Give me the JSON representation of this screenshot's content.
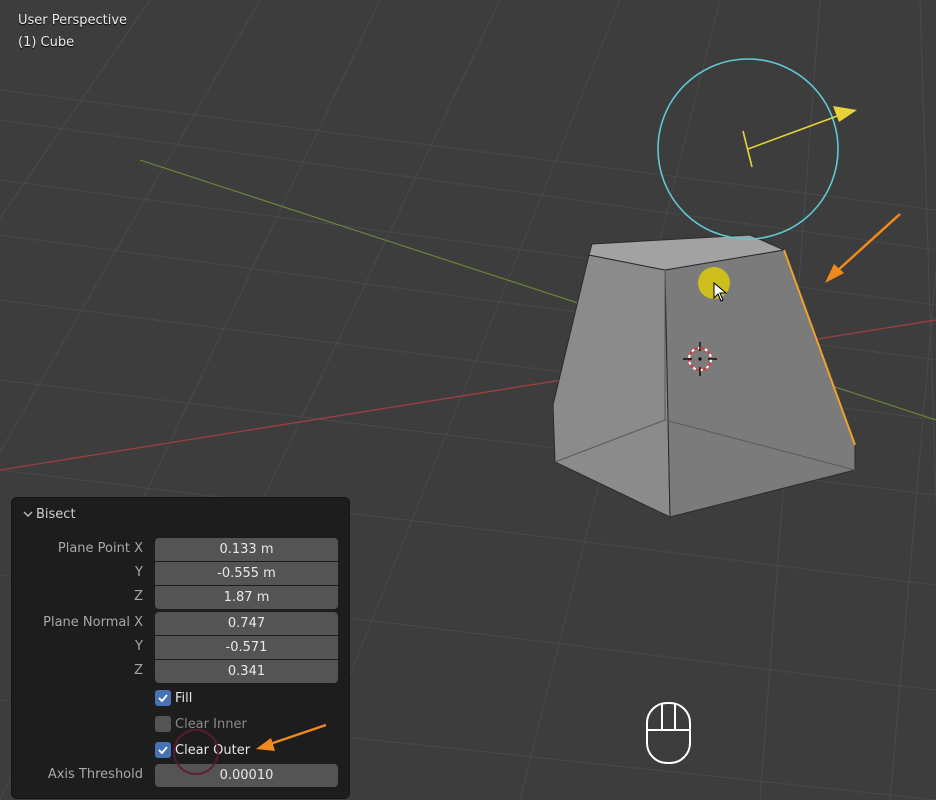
{
  "viewport": {
    "mode_label": "User Perspective",
    "object_label": "(1) Cube"
  },
  "operator_panel": {
    "title": "Bisect",
    "plane_point": {
      "label": "Plane Point X",
      "y_label": "Y",
      "z_label": "Z",
      "x": "0.133 m",
      "y": "-0.555 m",
      "z": "1.87 m"
    },
    "plane_normal": {
      "label": "Plane Normal X",
      "y_label": "Y",
      "z_label": "Z",
      "x": "0.747",
      "y": "-0.571",
      "z": "0.341"
    },
    "fill": {
      "label": "Fill",
      "checked": true
    },
    "clear_inner": {
      "label": "Clear Inner",
      "checked": false
    },
    "clear_outer": {
      "label": "Clear Outer",
      "checked": true
    },
    "axis_threshold": {
      "label": "Axis Threshold",
      "value": "0.00010"
    }
  },
  "colors": {
    "viewport_bg": "#3d3d3d",
    "grid": "#4a4a4a",
    "x_axis": "#9e3f3f",
    "y_axis": "#6e8a3a",
    "gizmo_ring": "#5fc9d6",
    "gizmo_arrow": "#e8d23a",
    "annotation_arrow": "#f08a1c",
    "checkbox_on": "#4772b3",
    "panel_bg": "#1d1d1d",
    "field_bg": "#545454"
  }
}
